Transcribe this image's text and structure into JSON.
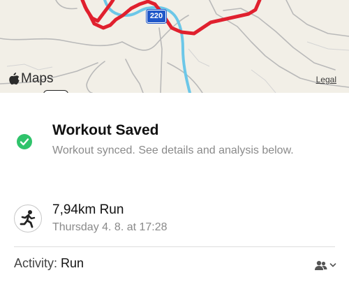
{
  "map": {
    "brand": "Maps",
    "legal": "Legal",
    "shield": "220",
    "route_color": "#e0202e",
    "river_color": "#6cc7e8",
    "shield_color": "#1f57c9"
  },
  "workout": {
    "title": "Workout Saved",
    "subtitle": "Workout synced. See details and analysis below.",
    "status_color": "#2fc36b"
  },
  "run": {
    "title": "7,94km Run",
    "date": "Thursday 4. 8. at 17:28"
  },
  "activity": {
    "label": "Activity:",
    "value": "Run"
  },
  "icons": {
    "logo": "apple-icon",
    "status": "checkmark-icon",
    "activity": "runner-icon",
    "people": "people-icon",
    "dropdown": "chevron-down-icon"
  }
}
